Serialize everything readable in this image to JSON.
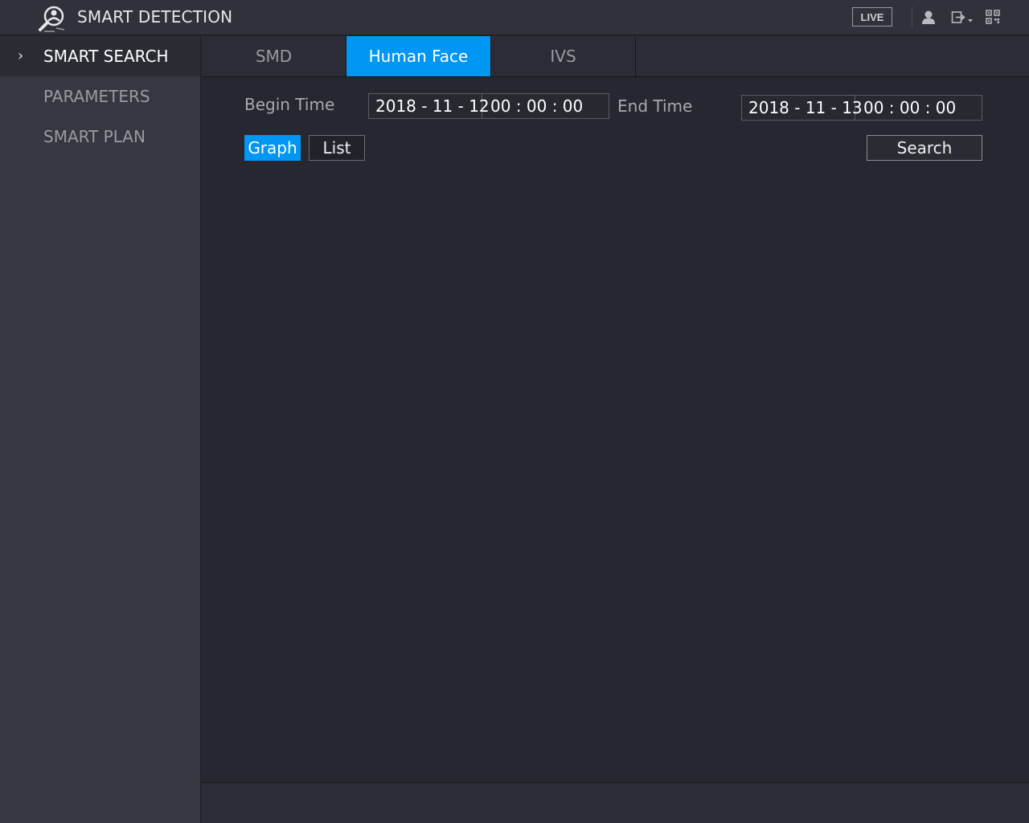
{
  "header": {
    "title": "SMART DETECTION",
    "logo_icon": "smart-detection-logo-icon",
    "live_label": "LIVE",
    "icons": [
      "user-icon",
      "logout-icon",
      "qr-code-icon"
    ]
  },
  "sidebar": {
    "items": [
      {
        "label": "SMART SEARCH",
        "active": true
      },
      {
        "label": "PARAMETERS",
        "active": false
      },
      {
        "label": "SMART PLAN",
        "active": false
      }
    ]
  },
  "tabs": [
    {
      "label": "SMD",
      "active": false
    },
    {
      "label": "Human Face",
      "active": true
    },
    {
      "label": "IVS",
      "active": false
    }
  ],
  "search": {
    "begin_label": "Begin Time",
    "begin_date": "2018 - 11 - 12",
    "begin_time": "00 : 00 : 00",
    "end_label": "End Time",
    "end_date": "2018 - 11 - 13",
    "end_time": "00 : 00 : 00",
    "graph_label": "Graph",
    "list_label": "List",
    "search_label": "Search",
    "selected_view": "Graph"
  },
  "colors": {
    "accent": "#0096f4",
    "background": "#262730",
    "sidebar": "#363741"
  }
}
